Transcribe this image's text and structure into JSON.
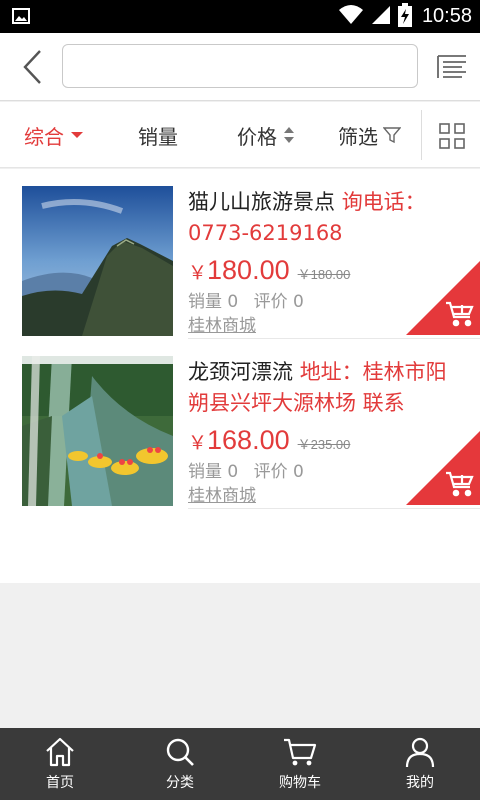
{
  "status_bar": {
    "time": "10:58",
    "icons": [
      "image-icon",
      "wifi-icon",
      "signal-icon",
      "battery-charging-icon"
    ]
  },
  "topbar": {
    "search_value": "",
    "search_placeholder": ""
  },
  "sortbar": {
    "items": [
      {
        "label": "综合",
        "active": true
      },
      {
        "label": "销量"
      },
      {
        "label": "价格"
      },
      {
        "label": "筛选"
      }
    ],
    "active_color": "#e23b3b"
  },
  "products": [
    {
      "title": "猫儿山旅游景点",
      "title_highlight": "询电话：0773-6219168",
      "currency": "￥",
      "price": "180.00",
      "old_price": "￥180.00",
      "sales": "销量 0",
      "reviews": "评价 0",
      "shop": "桂林商城"
    },
    {
      "title": "龙颈河漂流",
      "title_highlight": "地址：桂林市阳朔县兴坪大源林场 联系",
      "currency": "￥",
      "price": "168.00",
      "old_price": "￥235.00",
      "sales": "销量 0",
      "reviews": "评价 0",
      "shop": "桂林商城"
    }
  ],
  "bottom_nav": {
    "items": [
      {
        "label": "首页",
        "icon": "home-icon"
      },
      {
        "label": "分类",
        "icon": "search-icon"
      },
      {
        "label": "购物车",
        "icon": "cart-icon"
      },
      {
        "label": "我的",
        "icon": "user-icon"
      }
    ]
  },
  "colors": {
    "accent": "#e23b3b",
    "nav_bg": "#3a3a3a"
  }
}
